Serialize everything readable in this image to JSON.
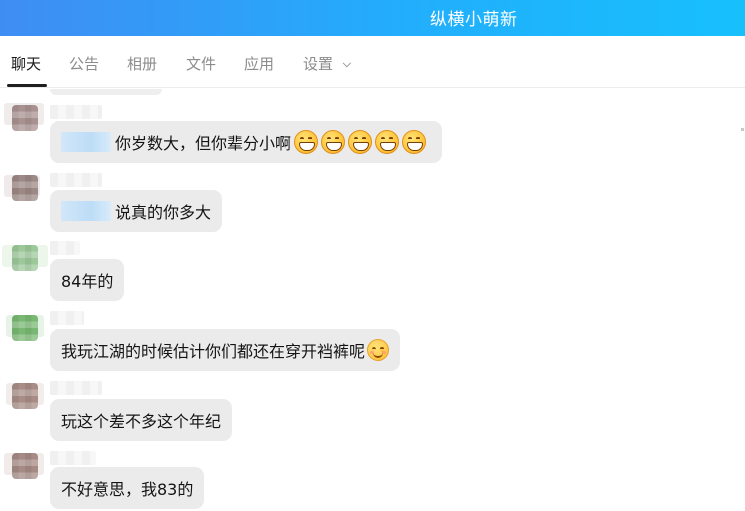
{
  "window": {
    "title": "纵横小萌新"
  },
  "tabs": [
    {
      "label": "聊天",
      "active": true
    },
    {
      "label": "公告",
      "active": false
    },
    {
      "label": "相册",
      "active": false
    },
    {
      "label": "文件",
      "active": false
    },
    {
      "label": "应用",
      "active": false
    },
    {
      "label": "设置",
      "active": false,
      "has_dropdown": true
    }
  ],
  "messages": [
    {
      "text": "你岁数大，但你辈分小啊",
      "has_mention": true,
      "emoji": "grinning-face",
      "emoji_count": 5,
      "avatar_color": "#a89290"
    },
    {
      "text": "说真的你多大",
      "has_mention": true,
      "avatar_color": "#9c8884"
    },
    {
      "text": "84年的",
      "has_mention": false,
      "avatar_color": "#9cc89a"
    },
    {
      "text": "我玩江湖的时候估计你们都还在穿开裆裤呢",
      "has_mention": false,
      "emoji": "smiling-face",
      "emoji_count": 1,
      "avatar_color": "#78b872"
    },
    {
      "text": "玩这个差不多这个年纪",
      "has_mention": false,
      "avatar_color": "#a88c86"
    },
    {
      "text": "不好意思，我83的",
      "has_mention": false,
      "avatar_color": "#a68a84"
    }
  ],
  "colors": {
    "titlebar_start": "#3f8df3",
    "titlebar_end": "#17c0fd",
    "bubble_bg": "#ebebeb",
    "mention_highlight": "#b7dbf8",
    "tab_active": "#1a1a1a",
    "tab_inactive": "#8c8c8c"
  }
}
